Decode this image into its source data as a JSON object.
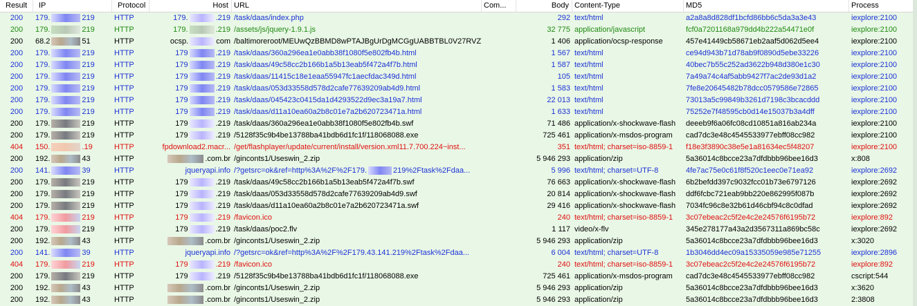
{
  "columns": {
    "result": "Result",
    "ip": "IP",
    "protocol": "Protocol",
    "host": "Host",
    "url": "URL",
    "comments": "Com...",
    "body": "Body",
    "content_type": "Content-Type",
    "md5": "MD5",
    "process": "Process"
  },
  "colors": {
    "blue": "#1b32d6",
    "green": "#1f8a12",
    "red": "#e01010",
    "black": "#000000",
    "row_bg": "#e9f7e6"
  },
  "rows": [
    {
      "color": "blue",
      "result": "200",
      "ip_a": "179.",
      "ip_b": "219",
      "blur": "purple",
      "protocol": "HTTP",
      "host_a": "179.",
      "host_b": ".219",
      "host_blur": "lavender",
      "url": "/task/daas/index.php",
      "body": "292",
      "ctype": "text/html",
      "md5": "a2a8a8d828df1bcfd86bb6c5da3a3e43",
      "process": "iexplore:2100"
    },
    {
      "color": "green",
      "result": "200",
      "ip_a": "179.",
      "ip_b": "219",
      "blur": "green",
      "protocol": "HTTP",
      "host_a": "179.",
      "host_b": ".219",
      "host_blur": "green",
      "url": "/assets/js/jquery-1.9.1.js",
      "body": "32 775",
      "ctype": "application/javascript",
      "md5": "fcf0a7201168a979dd4b222a54471e0f",
      "process": "iexplore:2100"
    },
    {
      "color": "black",
      "result": "200",
      "ip_a": "68.2",
      "ip_b": "51",
      "blur": "brown",
      "protocol": "HTTP",
      "host_a": "ocsp.",
      "host_b": "com",
      "host_blur": "lavender",
      "url": "/baltimoreroot/MEUwQzBBMD8wPTAJBgUrDgMCGgUABBTBL0V27RVZ7...",
      "body": "1 406",
      "ctype": "application/ocsp-response",
      "md5": "457e41449cb58671eb2aaf5d062d5ee4",
      "process": "iexplore:2100"
    },
    {
      "color": "blue",
      "result": "200",
      "ip_a": "179.",
      "ip_b": "219",
      "blur": "purple",
      "protocol": "HTTP",
      "host_a": "179",
      "host_b": ".219",
      "host_blur": "purple",
      "url": "/task/daas/360a296ea1e0abb38f1080f5e802fb4b.html",
      "body": "1 567",
      "ctype": "text/html",
      "md5": "ce94d943b71d78ab9f0890d5ebe33226",
      "process": "iexplore:2100"
    },
    {
      "color": "blue",
      "result": "200",
      "ip_a": "179.",
      "ip_b": "219",
      "blur": "purple",
      "protocol": "HTTP",
      "host_a": "179",
      "host_b": ".219",
      "host_blur": "purple",
      "url": "/task/daas/49c58cc2b166b1a5b13eab5f472a4f7b.html",
      "body": "1 587",
      "ctype": "text/html",
      "md5": "40bec7b55c252ad3622b948d380e1c30",
      "process": "iexplore:2100"
    },
    {
      "color": "blue",
      "result": "200",
      "ip_a": "179.",
      "ip_b": "219",
      "blur": "purple",
      "protocol": "HTTP",
      "host_a": "179",
      "host_b": ".219",
      "host_blur": "purple",
      "url": "/task/daas/11415c18e1eaa55947fc1aecfdac349d.html",
      "body": "105",
      "ctype": "text/html",
      "md5": "7a49a74c4af5abb9427f7ac2de93d1a2",
      "process": "iexplore:2100"
    },
    {
      "color": "blue",
      "result": "200",
      "ip_a": "179.",
      "ip_b": "219",
      "blur": "purple",
      "protocol": "HTTP",
      "host_a": "179",
      "host_b": ".219",
      "host_blur": "purple",
      "url": "/task/daas/053d33558d578d2cafe77639209ab4d9.html",
      "body": "1 583",
      "ctype": "text/html",
      "md5": "7fe8e20645482b78dcc0579586e72865",
      "process": "iexplore:2100"
    },
    {
      "color": "blue",
      "result": "200",
      "ip_a": "179.",
      "ip_b": "219",
      "blur": "purple",
      "protocol": "HTTP",
      "host_a": "179",
      "host_b": ".219",
      "host_blur": "purple",
      "url": "/task/daas/045423c0415da1d4293522d9ec3a19a7.html",
      "body": "22 013",
      "ctype": "text/html",
      "md5": "73013a5c99849b3261d7198c3bcacddd",
      "process": "iexplore:2100"
    },
    {
      "color": "blue",
      "result": "200",
      "ip_a": "179.",
      "ip_b": "219",
      "blur": "purple",
      "protocol": "HTTP",
      "host_a": "179",
      "host_b": ".219",
      "host_blur": "purple",
      "url": "/task/daas/d11a10ea60a2b8c01e7a2b620723471a.html",
      "body": "1 633",
      "ctype": "text/html",
      "md5": "75252e7f48595cb0d14e15037b3a4dff",
      "process": "iexplore:2100"
    },
    {
      "color": "black",
      "result": "200",
      "ip_a": "179.",
      "ip_b": "219",
      "blur": "gray",
      "protocol": "HTTP",
      "host_a": "179",
      "host_b": ".219",
      "host_blur": "lavender",
      "url": "/task/daas/360a296ea1e0abb38f1080f5e802fb4b.swf",
      "body": "71 486",
      "ctype": "application/x-shockwave-flash",
      "md5": "deeeb9f6a06fc08cd10851a816ab234a",
      "process": "iexplore:2100"
    },
    {
      "color": "black",
      "result": "200",
      "ip_a": "179.",
      "ip_b": "219",
      "blur": "gray",
      "protocol": "HTTP",
      "host_a": "179",
      "host_b": ".219",
      "host_blur": "lavender",
      "url": "/5128f35c9b4be13788ba41bdb6d1fc1f/118068088.exe",
      "body": "725 461",
      "ctype": "application/x-msdos-program",
      "md5": "cad7dc3e48c4545533977ebff08cc982",
      "process": "iexplore:2100"
    },
    {
      "color": "red",
      "result": "404",
      "ip_a": "150.",
      "ip_b": ".19",
      "blur": "peach",
      "protocol": "HTTP",
      "host_a": "fpdownload2.macr...",
      "host_b": "",
      "host_blur": "",
      "url": "/get/flashplayer/update/current/install/version.xml11.7.700.224~inst...",
      "body": "351",
      "ctype": "text/html; charset=iso-8859-1",
      "md5": "f18e3f3890c38e5e1a81634ec5f48207",
      "process": "iexplore:2100"
    },
    {
      "color": "black",
      "result": "200",
      "ip_a": "192.",
      "ip_b": "43",
      "blur": "brown",
      "protocol": "HTTP",
      "host_a": "",
      "host_b": ".com.br",
      "host_blur": "brown",
      "url": "/ginconts1/Useswin_2.zip",
      "body": "5 946 293",
      "ctype": "application/zip",
      "md5": "5a36014c8bcce23a7dfdbbb96bee16d3",
      "process": "x:808"
    },
    {
      "color": "blue",
      "result": "200",
      "ip_a": "141.",
      "ip_b": "39",
      "blur": "purple",
      "protocol": "HTTP",
      "host_a": "",
      "host_b": "jqueryapi.info",
      "host_blur": "",
      "url": "/?getsrc=ok&ref=http%3A%2F%2F179.",
      "url2": "219%2Ftask%2Fdaa...",
      "body": "5 996",
      "ctype": "text/html; charset=UTF-8",
      "md5": "4fe7ac75e0c61f8f520c1eec0e71ea92",
      "process": "iexplore:2692"
    },
    {
      "color": "black",
      "result": "200",
      "ip_a": "179.",
      "ip_b": "219",
      "blur": "gray",
      "protocol": "HTTP",
      "host_a": "179",
      "host_b": ".219",
      "host_blur": "lavender",
      "url": "/task/daas/49c58cc2b166b1a5b13eab5f472a4f7b.swf",
      "body": "76 663",
      "ctype": "application/x-shockwave-flash",
      "md5": "6b2befdd397c9032fcc01b73e6797126",
      "process": "iexplore:2692"
    },
    {
      "color": "black",
      "result": "200",
      "ip_a": "179.",
      "ip_b": "219",
      "blur": "gray",
      "protocol": "HTTP",
      "host_a": "179",
      "host_b": ".219",
      "host_blur": "lavender",
      "url": "/task/daas/053d33558d578d2cafe77639209ab4d9.swf",
      "body": "20 814",
      "ctype": "application/x-shockwave-flash",
      "md5": "ddf6fcbc721eab9bb220e862995f087b",
      "process": "iexplore:2692"
    },
    {
      "color": "black",
      "result": "200",
      "ip_a": "179.",
      "ip_b": "219",
      "blur": "gray",
      "protocol": "HTTP",
      "host_a": "179",
      "host_b": ".219",
      "host_blur": "lavender",
      "url": "/task/daas/d11a10ea60a2b8c01e7a2b620723471a.swf",
      "body": "29 416",
      "ctype": "application/x-shockwave-flash",
      "md5": "7034fc96c8e32b61d46cbf94c8c0dfad",
      "process": "iexplore:2692"
    },
    {
      "color": "red",
      "result": "404",
      "ip_a": "179.",
      "ip_b": "219",
      "blur": "pink",
      "protocol": "HTTP",
      "host_a": "179",
      "host_b": ".219",
      "host_blur": "lavender",
      "url": "/favicon.ico",
      "body": "240",
      "ctype": "text/html; charset=iso-8859-1",
      "md5": "3c07ebeac2c5f2e4c2e24576f6195b72",
      "process": "iexplore:892"
    },
    {
      "color": "black",
      "result": "200",
      "ip_a": "179.",
      "ip_b": "219",
      "blur": "pink",
      "protocol": "HTTP",
      "host_a": "179",
      "host_b": ".219",
      "host_blur": "lavender",
      "url": "/task/daas/poc2.flv",
      "body": "1 117",
      "ctype": "video/x-flv",
      "md5": "345e278177a43a2d3567311a869bc58c",
      "process": "iexplore:2692"
    },
    {
      "color": "black",
      "result": "200",
      "ip_a": "192.",
      "ip_b": "43",
      "blur": "brown",
      "protocol": "HTTP",
      "host_a": "",
      "host_b": ".com.br",
      "host_blur": "brown",
      "url": "/ginconts1/Useswin_2.zip",
      "body": "5 946 293",
      "ctype": "application/zip",
      "md5": "5a36014c8bcce23a7dfdbbb96bee16d3",
      "process": "x:3020"
    },
    {
      "color": "blue",
      "result": "200",
      "ip_a": "141.",
      "ip_b": "39",
      "blur": "purple",
      "protocol": "HTTP",
      "host_a": "",
      "host_b": "jqueryapi.info",
      "host_blur": "",
      "url": "/?getsrc=ok&ref=http%3A%2F%2F179.43.141.219%2Ftask%2Fdaa...",
      "body": "6 004",
      "ctype": "text/html; charset=UTF-8",
      "md5": "1b3046dd4ec09a15335059e985e71255",
      "process": "iexplore:2896"
    },
    {
      "color": "red",
      "result": "404",
      "ip_a": "179.",
      "ip_b": "219",
      "blur": "pink",
      "protocol": "HTTP",
      "host_a": "179",
      "host_b": ".219",
      "host_blur": "lavender",
      "url": "/favicon.ico",
      "body": "240",
      "ctype": "text/html; charset=iso-8859-1",
      "md5": "3c07ebeac2c5f2e4c2e24576f6195b72",
      "process": "iexplore:892"
    },
    {
      "color": "black",
      "result": "200",
      "ip_a": "179.",
      "ip_b": "219",
      "blur": "gray",
      "protocol": "HTTP",
      "host_a": "179",
      "host_b": ".219",
      "host_blur": "lavender",
      "url": "/5128f35c9b4be13788ba41bdb6d1fc1f/118068088.exe",
      "body": "725 461",
      "ctype": "application/x-msdos-program",
      "md5": "cad7dc3e48c4545533977ebff08cc982",
      "process": "cscript:544"
    },
    {
      "color": "black",
      "result": "200",
      "ip_a": "192.",
      "ip_b": "43",
      "blur": "brown",
      "protocol": "HTTP",
      "host_a": "",
      "host_b": ".com.br",
      "host_blur": "brown",
      "url": "/ginconts1/Useswin_2.zip",
      "body": "5 946 293",
      "ctype": "application/zip",
      "md5": "5a36014c8bcce23a7dfdbbb96bee16d3",
      "process": "x:3620"
    },
    {
      "color": "black",
      "result": "200",
      "ip_a": "192.",
      "ip_b": "43",
      "blur": "brown",
      "protocol": "HTTP",
      "host_a": "",
      "host_b": ".com.br",
      "host_blur": "brown",
      "url": "/ginconts1/Useswin_2.zip",
      "body": "5 946 293",
      "ctype": "application/zip",
      "md5": "5a36014c8bcce23a7dfdbbb96bee16d3",
      "process": "2:3808"
    }
  ]
}
